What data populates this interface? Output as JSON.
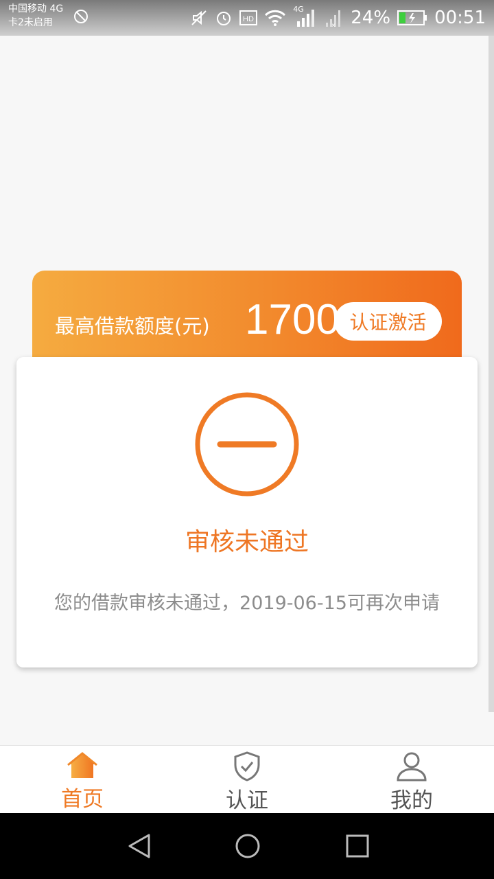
{
  "status_bar": {
    "carrier_line1": "中国移动 4G",
    "carrier_line2": "卡2未启用",
    "network_small": "4G",
    "battery_percent": "24%",
    "time": "00:51",
    "icons": [
      "no-alarm-icon",
      "mute-icon",
      "alarm-icon",
      "hd-icon",
      "wifi-icon",
      "signal-4g-icon",
      "signal-no-sim-icon",
      "battery-charging-icon"
    ]
  },
  "quota": {
    "label": "最高借款额度(元)",
    "amount": "1700",
    "activate_button": "认证激活"
  },
  "review_status": {
    "icon": "minus-circle-icon",
    "title": "审核未通过",
    "description": "您的借款审核未通过，2019-06-15可再次申请"
  },
  "bottom_nav": {
    "items": [
      {
        "label": "首页",
        "icon": "home-icon",
        "active": true
      },
      {
        "label": "认证",
        "icon": "shield-check-icon",
        "active": false
      },
      {
        "label": "我的",
        "icon": "user-icon",
        "active": false
      }
    ]
  },
  "system_nav": [
    "back-icon",
    "home-circle-icon",
    "recents-icon"
  ],
  "colors": {
    "accent": "#ef7a25",
    "banner_start": "#f5ab40",
    "banner_end": "#f06a1c",
    "text_muted": "#8c8c8c"
  }
}
